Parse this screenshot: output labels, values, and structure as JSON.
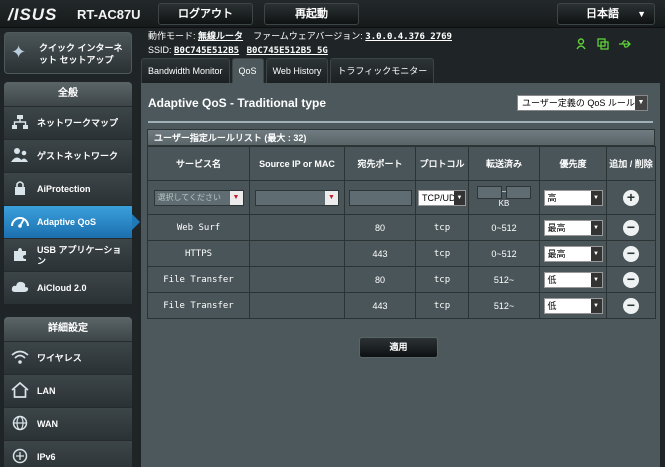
{
  "header": {
    "brand": "/ISUS",
    "model": "RT-AC87U",
    "logout_label": "ログアウト",
    "reboot_label": "再起動",
    "language": "日本語"
  },
  "info": {
    "mode_label": "動作モード:",
    "mode_value": "無線ルータ",
    "firmware_label": "ファームウェアバージョン:",
    "firmware_value": "3.0.0.4.376_2769",
    "ssid_label": "SSID:",
    "ssid_1": "B0C745E512B5",
    "ssid_2": "B0C745E512B5_5G"
  },
  "sidebar": {
    "quick_setup": "クイック インターネット セットアップ",
    "general_title": "全般",
    "general_items": [
      {
        "label": "ネットワークマップ",
        "icon": "network-map-icon"
      },
      {
        "label": "ゲストネットワーク",
        "icon": "guest-network-icon"
      },
      {
        "label": "AiProtection",
        "icon": "lock-icon"
      },
      {
        "label": "Adaptive QoS",
        "icon": "qos-icon"
      },
      {
        "label": "USB アプリケーション",
        "icon": "puzzle-icon"
      },
      {
        "label": "AiCloud 2.0",
        "icon": "cloud-icon"
      }
    ],
    "advanced_title": "詳細設定",
    "advanced_items": [
      {
        "label": "ワイヤレス",
        "icon": "wifi-icon"
      },
      {
        "label": "LAN",
        "icon": "home-icon"
      },
      {
        "label": "WAN",
        "icon": "globe-icon"
      },
      {
        "label": "IPv6",
        "icon": "ipv6-icon"
      }
    ]
  },
  "tabs": [
    "Bandwidth Monitor",
    "QoS",
    "Web History",
    "トラフィックモニター"
  ],
  "main": {
    "title": "Adaptive QoS - Traditional type",
    "mode_select": "ユーザー定義の QoS ルール",
    "table_title": "ユーザー指定ルールリスト (最大 : 32)",
    "columns": [
      "サービス名",
      "Source IP or MAC",
      "宛先ポート",
      "プロトコル",
      "転送済み",
      "優先度",
      "追加 / 削除"
    ],
    "input_row": {
      "service_placeholder": "選択してください",
      "protocol": "TCP/UDP",
      "transferred_tilde": "~",
      "transferred_unit": "KB",
      "priority": "高"
    },
    "rows": [
      {
        "service": "Web Surf",
        "source": "",
        "port": "80",
        "protocol": "tcp",
        "transferred": "0~512",
        "priority": "最高"
      },
      {
        "service": "HTTPS",
        "source": "",
        "port": "443",
        "protocol": "tcp",
        "transferred": "0~512",
        "priority": "最高"
      },
      {
        "service": "File Transfer",
        "source": "",
        "port": "80",
        "protocol": "tcp",
        "transferred": "512~",
        "priority": "低"
      },
      {
        "service": "File Transfer",
        "source": "",
        "port": "443",
        "protocol": "tcp",
        "transferred": "512~",
        "priority": "低"
      }
    ],
    "apply_label": "適用"
  },
  "colors": {
    "accent": "#2a8ccc",
    "status_green": "#5fcf3a",
    "remove_red": "#c61e2e"
  }
}
